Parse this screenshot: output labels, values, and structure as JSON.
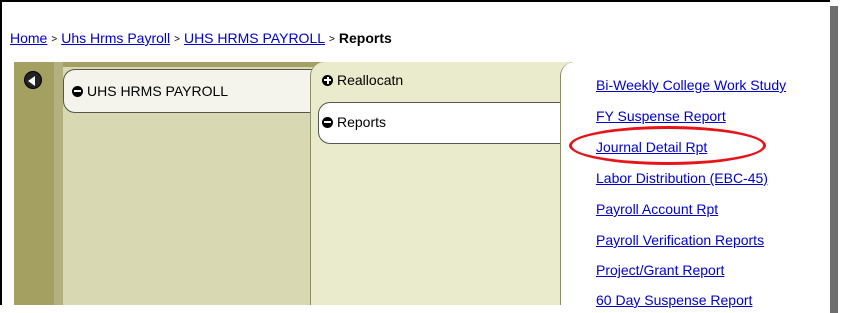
{
  "breadcrumb": {
    "home": "Home",
    "level1": "Uhs Hrms Payroll",
    "level2": "UHS HRMS PAYROLL",
    "current": "Reports",
    "separator": ">"
  },
  "nav": {
    "column1": {
      "item": "UHS HRMS PAYROLL"
    },
    "column2": {
      "items": [
        "Reallocatn",
        "Reports"
      ]
    },
    "reports": [
      "Bi-Weekly College Work Study",
      "FY Suspense Report",
      "Journal Detail Rpt",
      "Labor Distribution (EBC-45)",
      "Payroll Account Rpt",
      "Payroll Verification Reports",
      "Project/Grant Report",
      "60 Day Suspense Report"
    ]
  },
  "colors": {
    "panel_olive": "#a4a062",
    "link_blue": "#0000cc",
    "highlight_red": "#e8141a"
  },
  "icons": {
    "back": "collapse-left-icon",
    "expanded": "minus-circle-icon",
    "collapsed": "plus-circle-icon"
  }
}
